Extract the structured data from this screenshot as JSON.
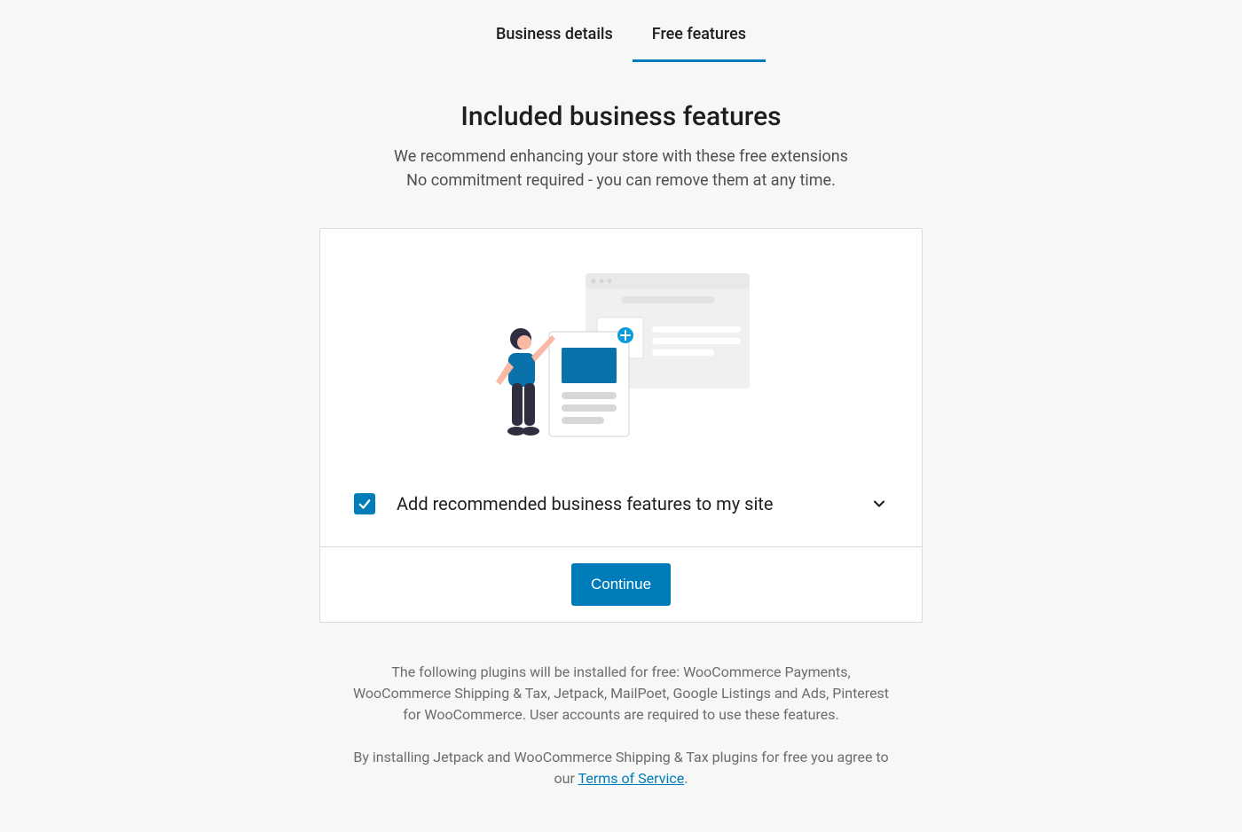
{
  "tabs": {
    "business_details": "Business details",
    "free_features": "Free features"
  },
  "header": {
    "title": "Included business features",
    "subtitle_line1": "We recommend enhancing your store with these free extensions",
    "subtitle_line2": "No commitment required - you can remove them at any time."
  },
  "option": {
    "label": "Add recommended business features to my site",
    "checked": true
  },
  "continue_label": "Continue",
  "footer": {
    "plugins_text": "The following plugins will be installed for free: WooCommerce Payments, WooCommerce Shipping & Tax, Jetpack, MailPoet, Google Listings and Ads, Pinterest for WooCommerce. User accounts are required to use these features.",
    "tos_prefix": "By installing Jetpack and WooCommerce Shipping & Tax plugins for free you agree to our ",
    "tos_link": "Terms of Service",
    "tos_suffix": "."
  }
}
